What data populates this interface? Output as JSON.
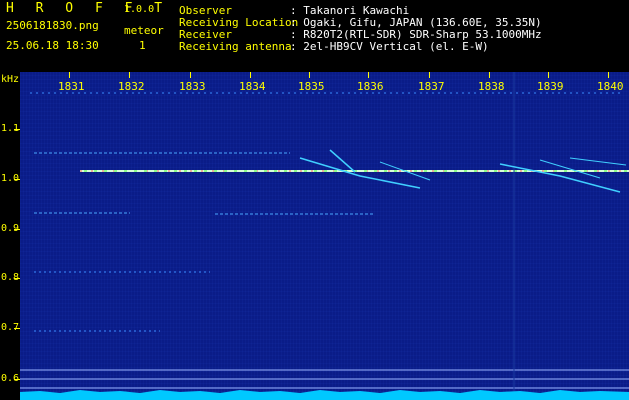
{
  "header": {
    "app_title": "H R O F F T",
    "version": "1.0.0",
    "filename": "2506181830.png",
    "datetime": "25.06.18 18:30",
    "meteor_label": "meteor",
    "meteor_count": "1",
    "info": [
      {
        "label": "Observer",
        "value": ": Takanori Kawachi"
      },
      {
        "label": "Receiving Location",
        "value": ": Ogaki, Gifu, JAPAN (136.60E, 35.35N)"
      },
      {
        "label": "Receiver",
        "value": ": R820T2(RTL-SDR) SDR-Sharp 53.1000MHz"
      },
      {
        "label": "Receiving antenna",
        "value": ": 2el-HB9CV Vertical (el. E-W)"
      }
    ]
  },
  "axes": {
    "y_unit": "kHz",
    "x_ticks": [
      "1831",
      "1832",
      "1833",
      "1834",
      "1835",
      "1836",
      "1837",
      "1838",
      "1839",
      "1840"
    ],
    "y_ticks": [
      "1.1",
      "1.0",
      "0.9",
      "0.8",
      "0.7",
      "0.6"
    ]
  },
  "colors": {
    "label": "#ffff00",
    "info_text": "#ffffff",
    "background": "#0a1c88",
    "noise_floor": "#00c8ff",
    "carrier": "#d0ffd0"
  }
}
